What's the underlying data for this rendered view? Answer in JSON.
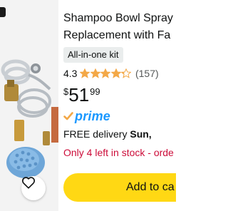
{
  "product": {
    "title_line1": "Shampoo Bowl Spray",
    "title_line2": "Replacement with Fa",
    "badge": "All-in-one kit",
    "rating_value": "4.3",
    "stars": 4.3,
    "review_count": "(157)",
    "price_symbol": "$",
    "price_whole": "51",
    "price_fraction": "99",
    "prime_label": "prime",
    "delivery_prefix": "FREE delivery ",
    "delivery_day": "Sun,",
    "stock_text": "Only 4 left in stock - orde",
    "add_to_cart_label": "Add to ca"
  },
  "colors": {
    "star": "#f3a847",
    "prime": "#1a98ff",
    "stock": "#cc0c39",
    "cart_button": "#ffd814"
  },
  "icons": {
    "wishlist": "heart-icon",
    "prime_check": "checkmark-icon",
    "star": "star-icon"
  }
}
